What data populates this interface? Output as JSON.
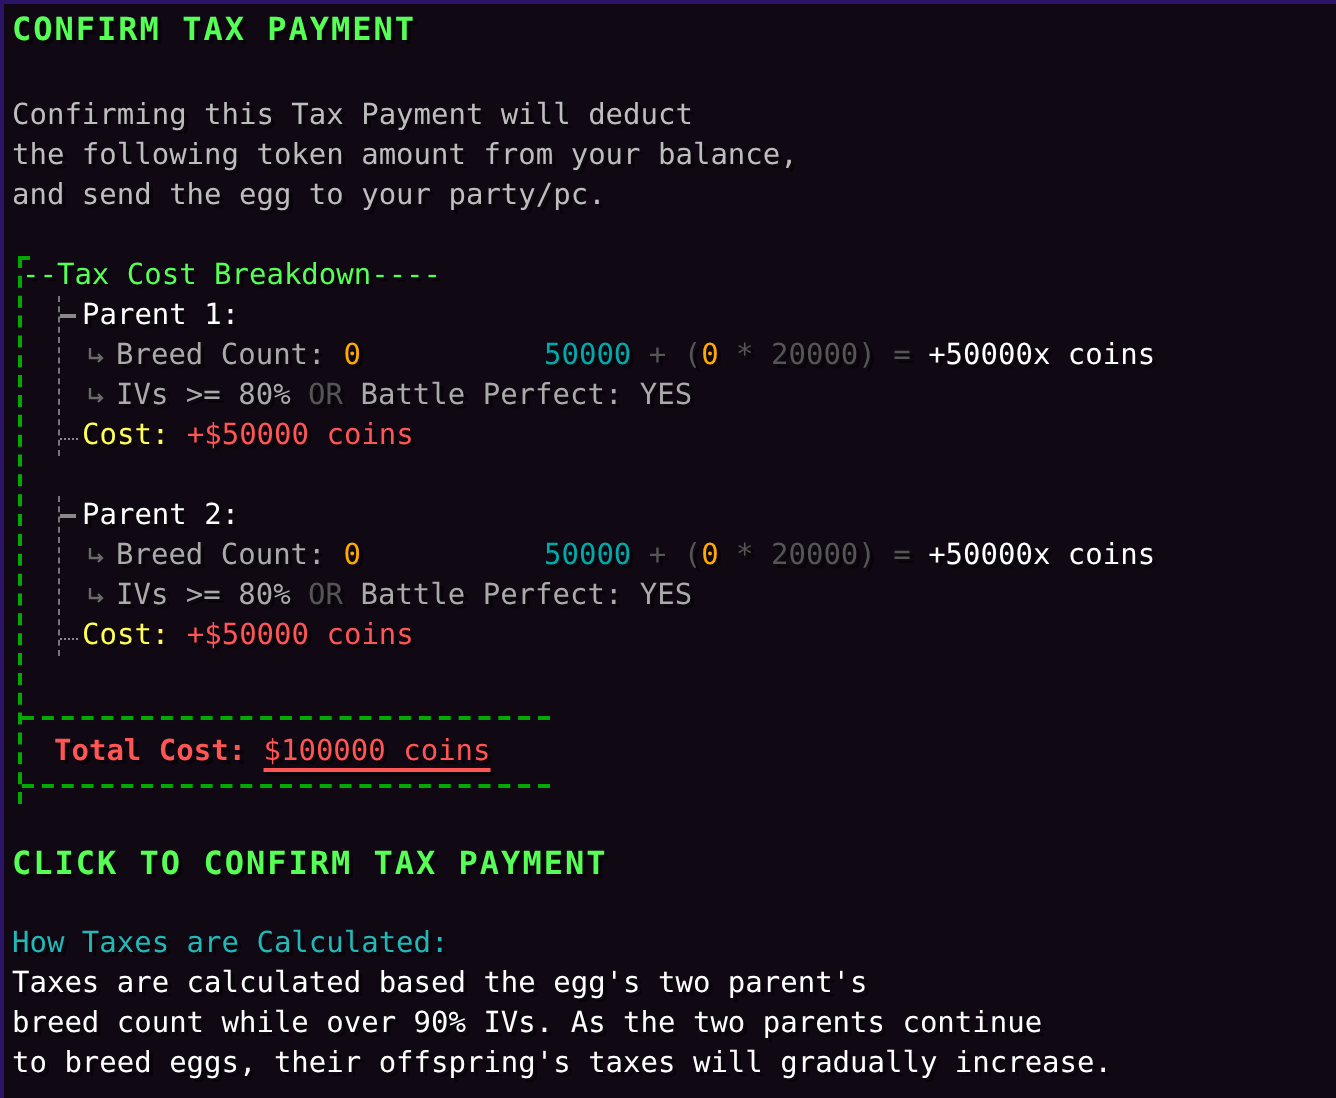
{
  "title": "CONFIRM TAX PAYMENT",
  "description": [
    "Confirming this Tax Payment will deduct",
    "the following token amount from your balance,",
    "and send the egg to your party/pc."
  ],
  "breakdown": {
    "heading": "--Tax Cost Breakdown----",
    "parents": [
      {
        "label": "Parent 1:",
        "breed_count_label": "Breed Count: ",
        "breed_count": "0",
        "formula": {
          "base": "50000",
          "op1": " + (",
          "count": "0",
          "op2": " * 20000) = ",
          "result": "+50000x coins"
        },
        "ivs": {
          "condition": "IVs >= 80% ",
          "or_word": "OR",
          "rest": " Battle Perfect: YES"
        },
        "cost_label": "Cost: ",
        "cost_value": "+$50000 coins"
      },
      {
        "label": "Parent 2:",
        "breed_count_label": "Breed Count: ",
        "breed_count": "0",
        "formula": {
          "base": "50000",
          "op1": " + (",
          "count": "0",
          "op2": " * 20000) = ",
          "result": "+50000x coins"
        },
        "ivs": {
          "condition": "IVs >= 80% ",
          "or_word": "OR",
          "rest": " Battle Perfect: YES"
        },
        "cost_label": "Cost: ",
        "cost_value": "+$50000 coins"
      }
    ],
    "total_label": "Total Cost: ",
    "total_value": "$100000 coins"
  },
  "action": "CLICK TO CONFIRM TAX PAYMENT",
  "how": {
    "title": "How Taxes are Calculated:",
    "lines": [
      "Taxes are calculated based the egg's two parent's",
      "breed count while over 90% IVs. As the two parents continue",
      "to breed eggs, their offspring's taxes will gradually increase."
    ]
  }
}
